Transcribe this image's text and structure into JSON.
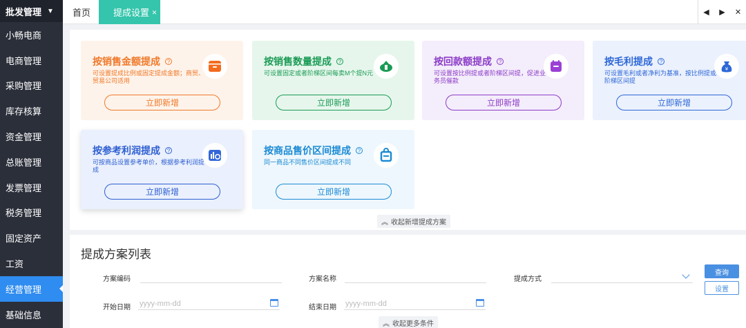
{
  "sidebar": {
    "header": "批发管理",
    "items": [
      {
        "label": "小畅电商"
      },
      {
        "label": "电商管理"
      },
      {
        "label": "采购管理"
      },
      {
        "label": "库存核算"
      },
      {
        "label": "资金管理"
      },
      {
        "label": "总账管理"
      },
      {
        "label": "发票管理"
      },
      {
        "label": "税务管理"
      },
      {
        "label": "固定资产"
      },
      {
        "label": "工资"
      },
      {
        "label": "经营管理"
      },
      {
        "label": "基础信息"
      }
    ],
    "active_index": 10
  },
  "tabs": {
    "home": "首页",
    "active": "提成设置",
    "close": "×"
  },
  "tab_nav": {
    "prev": "◀",
    "next": "▶",
    "close": "✕"
  },
  "cards": [
    {
      "title": "按销售金额提成",
      "desc": "可设置提成比例或固定提成金额；商贸、贸易公司适用",
      "button": "立即新增",
      "icon": "archive-box-icon"
    },
    {
      "title": "按销售数量提成",
      "desc": "可设置固定或者阶梯区间每卖M个提N元",
      "button": "立即新增",
      "icon": "upload-cloud-icon"
    },
    {
      "title": "按回款额提成",
      "desc": "可设置按比例提或者阶梯区间提，促进业务员催款",
      "button": "立即新增",
      "icon": "calendar-icon"
    },
    {
      "title": "按毛利提成",
      "desc": "可设置毛利或者净利为基准，按比例提或阶梯区间提",
      "button": "立即新增",
      "icon": "money-bag-icon"
    },
    {
      "title": "按参考利润提成",
      "desc": "可按商品设置参考单价，根据参考利润提成",
      "button": "立即新增",
      "icon": "chart-coin-icon"
    },
    {
      "title": "按商品售价区间提成",
      "desc": "同一商品不同售价区间提成不同",
      "button": "立即新增",
      "icon": "shopping-bag-icon"
    }
  ],
  "collapse_add": "收起新增提成方案",
  "list": {
    "title": "提成方案列表",
    "fields": {
      "code_label": "方案编码",
      "name_label": "方案名称",
      "method_label": "提成方式",
      "start_label": "开始日期",
      "start_placeholder": "yyyy-mm-dd",
      "end_label": "结束日期",
      "end_placeholder": "yyyy-mm-dd"
    },
    "query_button": "查询",
    "settings_button": "设置",
    "collapse_more": "收起更多条件"
  }
}
